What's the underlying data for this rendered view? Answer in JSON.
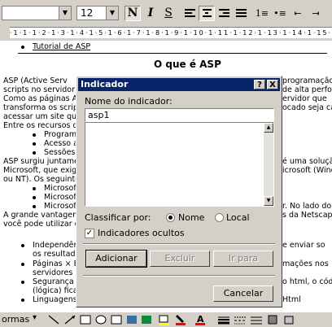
{
  "toolbar": {
    "font_size": "12",
    "bold": "N",
    "italic": "I",
    "underline": "S"
  },
  "document": {
    "link_item": "Tutorial de ASP",
    "heading": "O que é ASP",
    "left_lines": [
      "ASP (Active Serv",
      "scripts no servidor, q",
      "Como as páginas AS",
      "transforma os scripts",
      "acessar um site que",
      "Entre os recursos qu"
    ],
    "left_bullets1": [
      "Programaçã",
      "Acesso a ba",
      "Sessões (pe"
    ],
    "left_mid": [
      "ASP surgiu juntamer",
      "Microsoft, que exige",
      "ou NT). Os seguintes"
    ],
    "left_bullets2": [
      "Microsoft Int",
      "Microsoft Pe",
      "Microsoft Pe"
    ],
    "left_bottom": [
      "A grande vantagem,",
      "você pode utilizar qu"
    ],
    "left_bullets3": [
      "Independên",
      "os resultado",
      "Páginas × B",
      "servidores S",
      "Segurança",
      "(lógica) fica",
      "Linguagens"
    ],
    "right_lines": [
      "programação p",
      "de alta perform",
      "ervidor que",
      "ocado seja cap",
      "é uma soluçã",
      "icrosoft (Windo",
      "r. No lado do c",
      "s da Netscape",
      "e enviar so",
      "mações nos",
      "o html, o códig",
      "Html"
    ]
  },
  "dialog": {
    "title": "Indicador",
    "help_button": "?",
    "close_button": "X",
    "name_label": "Nome do indicador:",
    "name_value": "asp1",
    "sort_label": "Classificar por:",
    "sort_options": [
      "Nome",
      "Local"
    ],
    "sort_selected": "Nome",
    "hidden_checkbox_label": "Indicadores ocultos",
    "hidden_checked": true,
    "buttons": {
      "add": "Adicionar",
      "delete": "Excluir",
      "goto": "Ir para",
      "cancel": "Cancelar"
    }
  },
  "drawbar": {
    "label": "ormas"
  }
}
